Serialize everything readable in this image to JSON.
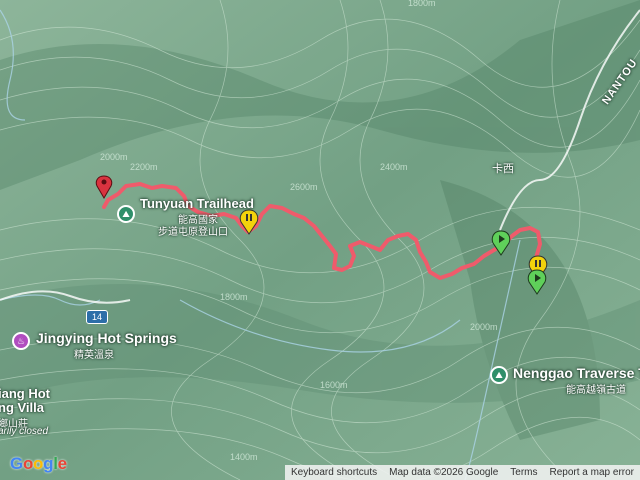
{
  "map": {
    "pois": [
      {
        "name": "Tunyuan Trailhead",
        "sub": "步道屯原登山口",
        "sub2": "能高國家",
        "icon": "park-icon"
      },
      {
        "name": "Jingying Hot Springs",
        "sub": "精英溫泉",
        "icon": "hot-spring-icon"
      },
      {
        "name": "Nenggao Traverse T",
        "sub": "能高越嶺古道",
        "icon": "park-icon"
      },
      {
        "name": "iang Hot",
        "sub": "ng Villa",
        "sub2": "鄉山莊",
        "sub3": "arily closed",
        "icon": "hotel-icon"
      }
    ],
    "place_labels": {
      "kaxi": "卡西",
      "road": "NANTOU",
      "route_number": "14"
    },
    "contour_labels": [
      "1800m",
      "2000m",
      "2200m",
      "2400m",
      "2600m",
      "1600m",
      "1800m",
      "2000m",
      "1400m"
    ],
    "track_color": "#ef5b6b"
  },
  "attribution": {
    "logo": "Google",
    "keyboard": "Keyboard shortcuts",
    "mapdata": "Map data ©2026 Google",
    "terms": "Terms",
    "report": "Report a map error"
  }
}
